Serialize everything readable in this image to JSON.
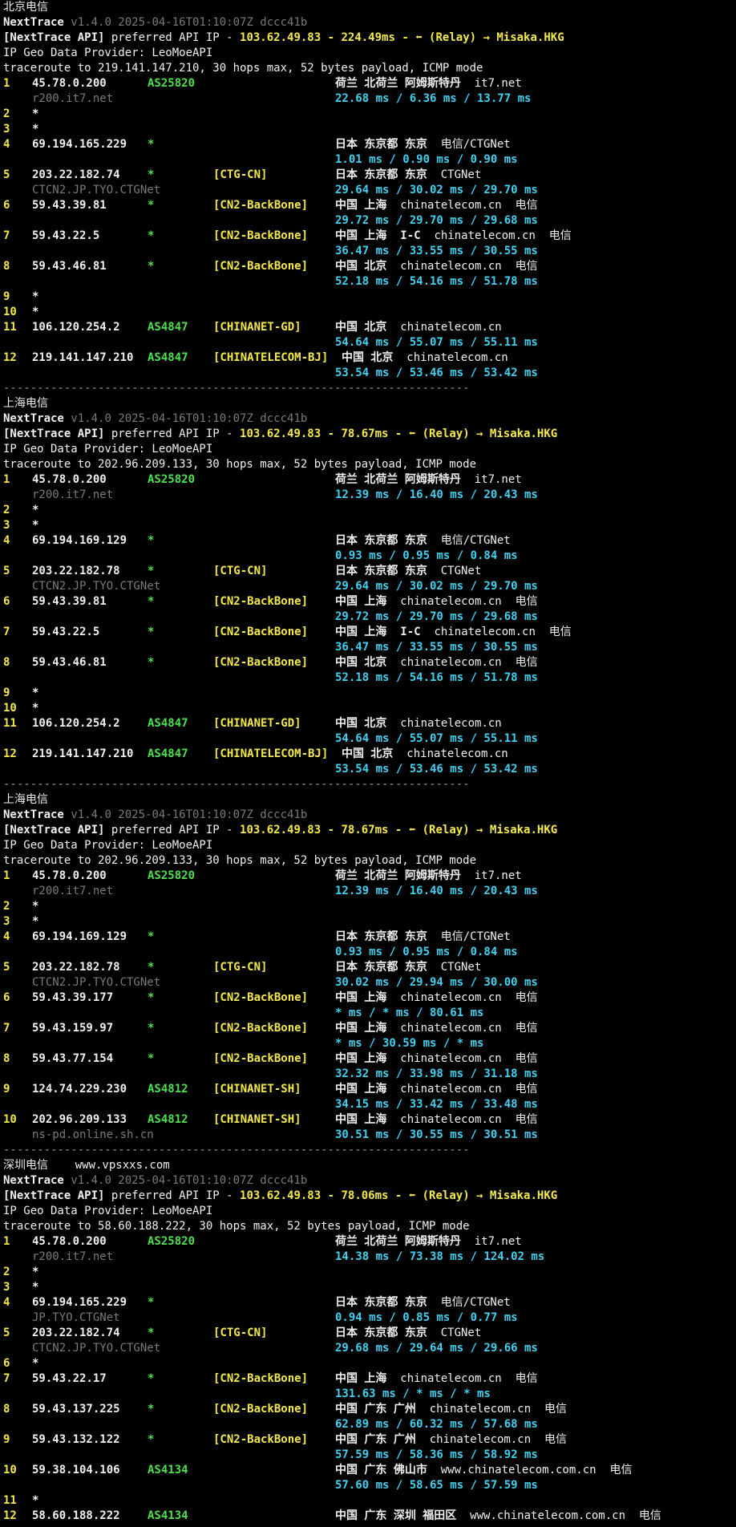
{
  "colors": {
    "background": "#000000",
    "hop": "#f5e94a",
    "asn": "#4ee04e",
    "rtt": "#40d0f0",
    "hostname": "#7a7a7a"
  },
  "separator": "---------------------------------------------------------------------",
  "blocks": [
    {
      "title": "北京电信",
      "app": "NextTrace",
      "version": "v1.4.0 2025-04-16T01:10:07Z dccc41b",
      "api_tag": "[NextTrace API]",
      "api_text": " preferred API IP - ",
      "api_ip": "103.62.49.83",
      "api_sep": " - ",
      "api_latency": "224.49ms",
      "api_relay": " - ⬅ (Relay) → Misaka.HKG",
      "geo_provider": "IP Geo Data Provider: LeoMoeAPI",
      "traceroute": "traceroute to 219.141.147.210, 30 hops max, 52 bytes payload, ICMP mode",
      "hops": [
        {
          "n": "1",
          "ip": "45.78.0.200",
          "asn": "AS25820",
          "tag": "",
          "geo": "荷兰 北荷兰 阿姆斯特丹",
          "domain": "it7.net",
          "isp": "",
          "host": "r200.it7.net",
          "rtt": "22.68 ms / 6.36 ms / 13.77 ms"
        },
        {
          "n": "2",
          "ip": "*"
        },
        {
          "n": "3",
          "ip": "*"
        },
        {
          "n": "4",
          "ip": "69.194.165.229",
          "asn": "*",
          "tag": "",
          "geo": "日本 东京都 东京",
          "domain": "电信/CTGNet",
          "isp": "",
          "host": "",
          "rtt": "1.01 ms / 0.90 ms / 0.90 ms"
        },
        {
          "n": "5",
          "ip": "203.22.182.74",
          "asn": "*",
          "tag": "[CTG-CN]",
          "geo": "日本 东京都 东京",
          "domain": "CTGNet",
          "isp": "",
          "host": "CTCN2.JP.TYO.CTGNet",
          "rtt": "29.64 ms / 30.02 ms / 29.70 ms"
        },
        {
          "n": "6",
          "ip": "59.43.39.81",
          "asn": "*",
          "tag": "[CN2-BackBone]",
          "geo": "中国 上海",
          "domain": "chinatelecom.cn",
          "isp": "电信",
          "host": "",
          "rtt": "29.72 ms / 29.70 ms / 29.68 ms"
        },
        {
          "n": "7",
          "ip": "59.43.22.5",
          "asn": "*",
          "tag": "[CN2-BackBone]",
          "geo": "中国 上海  I-C",
          "domain": "chinatelecom.cn",
          "isp": "电信",
          "host": "",
          "rtt": "36.47 ms / 33.55 ms / 30.55 ms"
        },
        {
          "n": "8",
          "ip": "59.43.46.81",
          "asn": "*",
          "tag": "[CN2-BackBone]",
          "geo": "中国 北京",
          "domain": "chinatelecom.cn",
          "isp": "电信",
          "host": "",
          "rtt": "52.18 ms / 54.16 ms / 51.78 ms"
        },
        {
          "n": "9",
          "ip": "*"
        },
        {
          "n": "10",
          "ip": "*"
        },
        {
          "n": "11",
          "ip": "106.120.254.2",
          "asn": "AS4847",
          "tag": "[CHINANET-GD]",
          "geo": "中国 北京",
          "domain": "chinatelecom.cn",
          "isp": "",
          "host": "",
          "rtt": "54.64 ms / 55.07 ms / 55.11 ms"
        },
        {
          "n": "12",
          "ip": "219.141.147.210",
          "asn": "AS4847",
          "tag": "[CHINATELECOM-BJ]",
          "geo": "中国 北京",
          "domain": "chinatelecom.cn",
          "isp": "",
          "host": "",
          "rtt": "53.54 ms / 53.46 ms / 53.42 ms",
          "wide": true
        }
      ]
    },
    {
      "title": "上海电信",
      "app": "NextTrace",
      "version": "v1.4.0 2025-04-16T01:10:07Z dccc41b",
      "api_tag": "[NextTrace API]",
      "api_text": " preferred API IP - ",
      "api_ip": "103.62.49.83",
      "api_sep": " - ",
      "api_latency": "78.67ms",
      "api_relay": " - ⬅ (Relay) → Misaka.HKG",
      "geo_provider": "IP Geo Data Provider: LeoMoeAPI",
      "traceroute": "traceroute to 202.96.209.133, 30 hops max, 52 bytes payload, ICMP mode",
      "hops": [
        {
          "n": "1",
          "ip": "45.78.0.200",
          "asn": "AS25820",
          "tag": "",
          "geo": "荷兰 北荷兰 阿姆斯特丹",
          "domain": "it7.net",
          "isp": "",
          "host": "r200.it7.net",
          "rtt": "12.39 ms / 16.40 ms / 20.43 ms"
        },
        {
          "n": "2",
          "ip": "*"
        },
        {
          "n": "3",
          "ip": "*"
        },
        {
          "n": "4",
          "ip": "69.194.169.129",
          "asn": "*",
          "tag": "",
          "geo": "日本 东京都 东京",
          "domain": "电信/CTGNet",
          "isp": "",
          "host": "",
          "rtt": "0.93 ms / 0.95 ms / 0.84 ms"
        },
        {
          "n": "5",
          "ip": "203.22.182.78",
          "asn": "*",
          "tag": "[CTG-CN]",
          "geo": "日本 东京都 东京",
          "domain": "CTGNet",
          "isp": "",
          "host": "CTCN2.JP.TYO.CTGNet",
          "rtt": "29.64 ms / 30.02 ms / 29.70 ms"
        },
        {
          "n": "6",
          "ip": "59.43.39.81",
          "asn": "*",
          "tag": "[CN2-BackBone]",
          "geo": "中国 上海",
          "domain": "chinatelecom.cn",
          "isp": "电信",
          "host": "",
          "rtt": "29.72 ms / 29.70 ms / 29.68 ms"
        },
        {
          "n": "7",
          "ip": "59.43.22.5",
          "asn": "*",
          "tag": "[CN2-BackBone]",
          "geo": "中国 上海  I-C",
          "domain": "chinatelecom.cn",
          "isp": "电信",
          "host": "",
          "rtt": "36.47 ms / 33.55 ms / 30.55 ms"
        },
        {
          "n": "8",
          "ip": "59.43.46.81",
          "asn": "*",
          "tag": "[CN2-BackBone]",
          "geo": "中国 北京",
          "domain": "chinatelecom.cn",
          "isp": "电信",
          "host": "",
          "rtt": "52.18 ms / 54.16 ms / 51.78 ms"
        },
        {
          "n": "9",
          "ip": "*"
        },
        {
          "n": "10",
          "ip": "*"
        },
        {
          "n": "11",
          "ip": "106.120.254.2",
          "asn": "AS4847",
          "tag": "[CHINANET-GD]",
          "geo": "中国 北京",
          "domain": "chinatelecom.cn",
          "isp": "",
          "host": "",
          "rtt": "54.64 ms / 55.07 ms / 55.11 ms"
        },
        {
          "n": "12",
          "ip": "219.141.147.210",
          "asn": "AS4847",
          "tag": "[CHINATELECOM-BJ]",
          "geo": "中国 北京",
          "domain": "chinatelecom.cn",
          "isp": "",
          "host": "",
          "rtt": "53.54 ms / 53.46 ms / 53.42 ms",
          "wide": true
        }
      ]
    },
    {
      "title": "上海电信",
      "app": "NextTrace",
      "version": "v1.4.0 2025-04-16T01:10:07Z dccc41b",
      "api_tag": "[NextTrace API]",
      "api_text": " preferred API IP - ",
      "api_ip": "103.62.49.83",
      "api_sep": " - ",
      "api_latency": "78.67ms",
      "api_relay": " - ⬅ (Relay) → Misaka.HKG",
      "geo_provider": "IP Geo Data Provider: LeoMoeAPI",
      "traceroute": "traceroute to 202.96.209.133, 30 hops max, 52 bytes payload, ICMP mode",
      "hops": [
        {
          "n": "1",
          "ip": "45.78.0.200",
          "asn": "AS25820",
          "tag": "",
          "geo": "荷兰 北荷兰 阿姆斯特丹",
          "domain": "it7.net",
          "isp": "",
          "host": "r200.it7.net",
          "rtt": "12.39 ms / 16.40 ms / 20.43 ms"
        },
        {
          "n": "2",
          "ip": "*"
        },
        {
          "n": "3",
          "ip": "*"
        },
        {
          "n": "4",
          "ip": "69.194.169.129",
          "asn": "*",
          "tag": "",
          "geo": "日本 东京都 东京",
          "domain": "电信/CTGNet",
          "isp": "",
          "host": "",
          "rtt": "0.93 ms / 0.95 ms / 0.84 ms"
        },
        {
          "n": "5",
          "ip": "203.22.182.78",
          "asn": "*",
          "tag": "[CTG-CN]",
          "geo": "日本 东京都 东京",
          "domain": "CTGNet",
          "isp": "",
          "host": "CTCN2.JP.TYO.CTGNet",
          "rtt": "30.02 ms / 29.94 ms / 30.00 ms"
        },
        {
          "n": "6",
          "ip": "59.43.39.177",
          "asn": "*",
          "tag": "[CN2-BackBone]",
          "geo": "中国 上海",
          "domain": "chinatelecom.cn",
          "isp": "电信",
          "host": "",
          "rtt": "* ms / * ms / 80.61 ms"
        },
        {
          "n": "7",
          "ip": "59.43.159.97",
          "asn": "*",
          "tag": "[CN2-BackBone]",
          "geo": "中国 上海",
          "domain": "chinatelecom.cn",
          "isp": "电信",
          "host": "",
          "rtt": "* ms / 30.59 ms / * ms"
        },
        {
          "n": "8",
          "ip": "59.43.77.154",
          "asn": "*",
          "tag": "[CN2-BackBone]",
          "geo": "中国 上海",
          "domain": "chinatelecom.cn",
          "isp": "电信",
          "host": "",
          "rtt": "32.32 ms / 33.98 ms / 31.18 ms"
        },
        {
          "n": "9",
          "ip": "124.74.229.230",
          "asn": "AS4812",
          "tag": "[CHINANET-SH]",
          "geo": "中国 上海",
          "domain": "chinatelecom.cn",
          "isp": "电信",
          "host": "",
          "rtt": "34.15 ms / 33.42 ms / 33.48 ms"
        },
        {
          "n": "10",
          "ip": "202.96.209.133",
          "asn": "AS4812",
          "tag": "[CHINANET-SH]",
          "geo": "中国 上海",
          "domain": "chinatelecom.cn",
          "isp": "电信",
          "host": "ns-pd.online.sh.cn",
          "rtt": "30.51 ms / 30.55 ms / 30.51 ms"
        }
      ]
    },
    {
      "title": "深圳电信    www.vpsxxs.com",
      "app": "NextTrace",
      "version": "v1.4.0 2025-04-16T01:10:07Z dccc41b",
      "api_tag": "[NextTrace API]",
      "api_text": " preferred API IP - ",
      "api_ip": "103.62.49.83",
      "api_sep": " - ",
      "api_latency": "78.06ms",
      "api_relay": " - ⬅ (Relay) → Misaka.HKG",
      "geo_provider": "IP Geo Data Provider: LeoMoeAPI",
      "traceroute": "traceroute to 58.60.188.222, 30 hops max, 52 bytes payload, ICMP mode",
      "hops": [
        {
          "n": "1",
          "ip": "45.78.0.200",
          "asn": "AS25820",
          "tag": "",
          "geo": "荷兰 北荷兰 阿姆斯特丹",
          "domain": "it7.net",
          "isp": "",
          "host": "r200.it7.net",
          "rtt": "14.38 ms / 73.38 ms / 124.02 ms"
        },
        {
          "n": "2",
          "ip": "*"
        },
        {
          "n": "3",
          "ip": "*"
        },
        {
          "n": "4",
          "ip": "69.194.165.229",
          "asn": "*",
          "tag": "",
          "geo": "日本 东京都 东京",
          "domain": "电信/CTGNet",
          "isp": "",
          "host": "JP.TYO.CTGNet",
          "rtt": "0.94 ms / 0.85 ms / 0.77 ms"
        },
        {
          "n": "5",
          "ip": "203.22.182.74",
          "asn": "*",
          "tag": "[CTG-CN]",
          "geo": "日本 东京都 东京",
          "domain": "CTGNet",
          "isp": "",
          "host": "CTCN2.JP.TYO.CTGNet",
          "rtt": "29.68 ms / 29.64 ms / 29.66 ms"
        },
        {
          "n": "6",
          "ip": "*"
        },
        {
          "n": "7",
          "ip": "59.43.22.17",
          "asn": "*",
          "tag": "[CN2-BackBone]",
          "geo": "中国 上海",
          "domain": "chinatelecom.cn",
          "isp": "电信",
          "host": "",
          "rtt": "131.63 ms / * ms / * ms"
        },
        {
          "n": "8",
          "ip": "59.43.137.225",
          "asn": "*",
          "tag": "[CN2-BackBone]",
          "geo": "中国 广东 广州",
          "domain": "chinatelecom.cn",
          "isp": "电信",
          "host": "",
          "rtt": "62.89 ms / 60.32 ms / 57.68 ms"
        },
        {
          "n": "9",
          "ip": "59.43.132.122",
          "asn": "*",
          "tag": "[CN2-BackBone]",
          "geo": "中国 广东 广州",
          "domain": "chinatelecom.cn",
          "isp": "电信",
          "host": "",
          "rtt": "57.59 ms / 58.36 ms / 58.92 ms"
        },
        {
          "n": "10",
          "ip": "59.38.104.106",
          "asn": "AS4134",
          "tag": "",
          "geo": "中国 广东 佛山市",
          "domain": "www.chinatelecom.com.cn",
          "isp": "电信",
          "host": "",
          "rtt": "57.60 ms / 58.65 ms / 57.59 ms"
        },
        {
          "n": "11",
          "ip": "*"
        },
        {
          "n": "12",
          "ip": "58.60.188.222",
          "asn": "AS4134",
          "tag": "",
          "geo": "中国 广东 深圳 福田区",
          "domain": "www.chinatelecom.com.cn",
          "isp": "电信",
          "host": "",
          "rtt": ""
        }
      ]
    }
  ]
}
